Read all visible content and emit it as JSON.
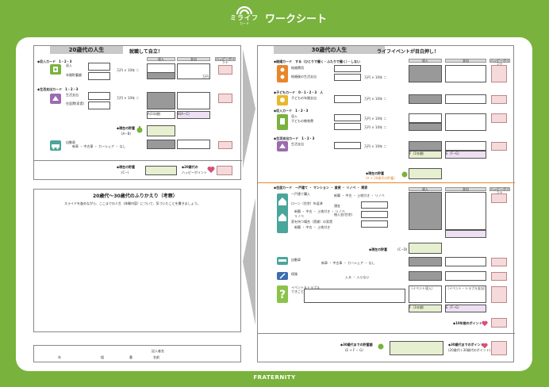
{
  "header": {
    "logo_text": "ミライフ",
    "logo_sub": "カード",
    "title": "ワークシート"
  },
  "footer": {
    "brand": "FRATERNITY"
  },
  "left_top": {
    "tab": "20歳代の人生",
    "heading": "就職して自立！",
    "col_income": "収入",
    "col_expense": "支出",
    "col_happy": "ハッピーポイント",
    "income_card": "◆収入カード　1・2・3",
    "income_label": "収入",
    "income_label2": "年間貯蓄額",
    "unit_man": "万円 × 10年 ＝",
    "unit_yen": "万円",
    "life_card": "◆生活支出カード　1・2・3",
    "life_label1": "生活支出",
    "life_label2": "住居費(家賃)",
    "sum_label": "A(1年間)",
    "sum_label2": "B(A−C)",
    "savings_now": "◆現在の貯蓄",
    "savings_formula": "(A−B)",
    "car_label": "自動車",
    "car_options": "新車 ・ 中古車 ・ カーシェア ・ なし",
    "savings_footer": "◆現在の貯蓄",
    "savings_footer_sub": "(C−)",
    "happy_footer": "◆20歳代の",
    "happy_footer_sub": "ハッピーポイント"
  },
  "left_review": {
    "title": "20歳代〜30歳代のふりかえり（考察）",
    "instruction": "スライドを進めながら、ここまでの人生（体験内容）について、気づいたことを書きましょう。"
  },
  "name_row": {
    "year": "年",
    "class": "組",
    "number": "番",
    "name": "名前",
    "name_note": "記入者名"
  },
  "right": {
    "tab": "30歳代の人生",
    "heading": "ライフイベントが目白押し！",
    "col_income": "収入",
    "col_expense": "支出",
    "col_happy": "ハッピーポイント",
    "marriage_card": "◆結婚カード　する（ひとりで働く・ふたりで働く）・しない",
    "marriage_l1": "結婚費用",
    "marriage_l2": "結婚後の生活支出",
    "child_card": "◆子どもカード　0・1・2・3　人",
    "child_l1": "子どもの年間支出",
    "income_card": "◆収入カード　1・2・3",
    "income_l1": "収入",
    "income_l2": "子どもの教育費",
    "life_card": "◆生活支出カード　1・2・3",
    "life_l1": "生活支出",
    "unit_man": "万円 × 10年 ＝",
    "unit_yen": "万円",
    "savings_now": "◆現在の貯蓄",
    "savings_sub": "(A + 20歳代の貯蓄)",
    "house_card": "◆住居カード　一戸建て ・ マンション ・ 賃貸 ・ リノベ ・ 実家",
    "house_l1": "一戸建て購入",
    "house_opts": "新築 ・ 中古 ・ 土地付き ・ リノベ",
    "house_l2": "ローン（住宅）年返済",
    "house_opt1": "頭金",
    "house_opt2": "借入金(住宅)",
    "house_l3": "家を持つ場合（賃貸）の家賃",
    "house_opts2": "新築 ・ 中古 ・ 土地付き ・ リノベ",
    "house_l4": "リノベ",
    "house_opts3": "新築 ・ 中古 ・ 土地付き",
    "savings_now2": "◆現在の貯蓄",
    "savings_formula2": "(C−D)",
    "car_label": "自動車",
    "car_options": "新車 ・ 中古車 ・ カーシェア ・ なし",
    "ins_label": "保険",
    "ins_options": "入る ・ 入らない",
    "event_label": "イベント＆トラブル",
    "event_sub": "できごと",
    "event_income": "（イベント収入）",
    "event_expense": "（イベント・トラブル支出）",
    "sum_label": "F（1年間）",
    "sum_label2": "E（F−G）",
    "happy_10": "◆10年間のポイント",
    "final_savings": "◆30歳代までの貯蓄額",
    "final_formula": "(E + F − G)",
    "final_happy": "◆30歳代までのポイント",
    "final_happy_sub": "(20歳代＋30歳代のポイント)"
  },
  "colors": {
    "green": "#79b23d",
    "orange": "#e8862a",
    "purple": "#9b6bb0",
    "teal": "#4aa59a",
    "pink": "#f6d9da",
    "heart": "#d94f7a"
  }
}
